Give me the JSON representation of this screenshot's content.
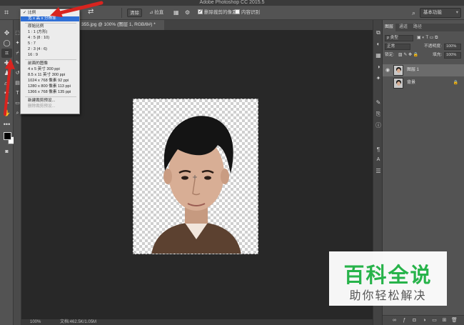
{
  "window": {
    "title": "Adobe Photoshop CC 2015.5"
  },
  "options_bar": {
    "ratio_value": "比例",
    "clear_label": "清除",
    "straighten_label": "拉直",
    "delete_cropped_label": "删除裁剪的像素",
    "content_aware_label": "内容识别",
    "workspace": "基本功能",
    "icons": [
      "crop-tool-icon",
      "swap-arrows-icon",
      "grid-overlay-icon",
      "gear-icon",
      "search-icon"
    ]
  },
  "document": {
    "tab_title": "355.jpg @ 100% (图层 1, RGB/8#) *",
    "zoom": "100%",
    "doc_size": "文档:462.5K/1.05M"
  },
  "ratio_menu": {
    "items": [
      {
        "label": "比例",
        "checked": true
      },
      {
        "label": "宽 x 高 x 分辨率",
        "selected": true
      },
      {
        "label": "原始比例",
        "head": true
      },
      {
        "label": "1 : 1 (方形)"
      },
      {
        "label": "4 : 5 (8 : 10)"
      },
      {
        "label": "5 : 7"
      },
      {
        "label": "2 : 3 (4 : 6)"
      },
      {
        "label": "16 : 9"
      },
      {
        "label": "前面的图像",
        "head": true
      },
      {
        "label": "4 x 5 英寸 300 ppi"
      },
      {
        "label": "8.5 x 11 英寸 300 ppi"
      },
      {
        "label": "1024 x 768 像素 92 ppi"
      },
      {
        "label": "1280 x 800 像素 113 ppi"
      },
      {
        "label": "1366 x 768 像素 135 ppi"
      },
      {
        "label": "新建裁剪预设..."
      },
      {
        "label": "删除裁剪预设...",
        "disabled": true
      }
    ]
  },
  "layers_panel": {
    "tabs": [
      "图层",
      "通道",
      "路径"
    ],
    "filter_label": "p 类型",
    "blend_mode": "正常",
    "opacity_label": "不透明度:",
    "opacity_value": "100%",
    "lock_label": "锁定:",
    "fill_label": "填充:",
    "fill_value": "100%",
    "layers": [
      {
        "name": "图层 1",
        "selected": true,
        "visible": true
      },
      {
        "name": "背景",
        "locked": true,
        "visible": false
      }
    ]
  },
  "watermark": {
    "title": "百科全说",
    "subtitle": "助你轻松解决"
  },
  "colors": {
    "accent": "#2f6fd6",
    "arrow": "#d8241f",
    "watermark_green": "#27b34a"
  }
}
